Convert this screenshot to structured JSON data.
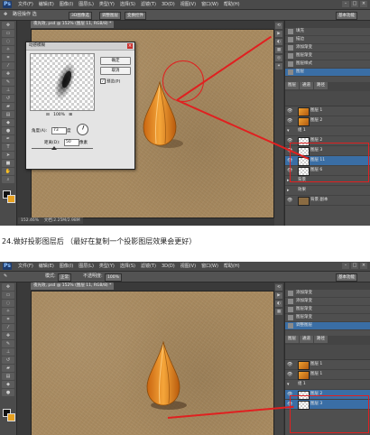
{
  "menu": [
    "文件(F)",
    "编辑(E)",
    "图像(I)",
    "图层(L)",
    "类型(Y)",
    "选择(S)",
    "滤镜(T)",
    "3D(D)",
    "视图(V)",
    "窗口(W)",
    "帮助(H)"
  ],
  "shot1": {
    "options": {
      "tool_label": "路径操作 选",
      "btn1": "3D图像选",
      "btn2": "调整图层",
      "btn3": "变换控件",
      "workspace": "基本功能"
    },
    "doc_tab": "夜光效, psd @ 152% (图层 11, RGB/8) *",
    "status": "152.46%",
    "status_doc": "文档:2.25M/2.98M",
    "dialog": {
      "title": "动感模糊",
      "ok": "确定",
      "cancel": "取消",
      "preview": "预览(P)",
      "zoom": "100%",
      "angle_label": "角度(A):",
      "angle_value": "73",
      "angle_unit": "度",
      "distance_label": "距离(D):",
      "distance_value": "50",
      "distance_unit": "像素"
    },
    "history": [
      "填充",
      "描边",
      "添加渐变",
      "图层渐变",
      "图层样式",
      "图层"
    ],
    "layers_tabs": [
      "图层",
      "通道",
      "路径"
    ],
    "layers": [
      {
        "name": "图层 1",
        "thumb": "drop"
      },
      {
        "name": "图层 2",
        "thumb": "drop"
      },
      {
        "name": "组 1",
        "thumb": "group"
      },
      {
        "name": "图层 2",
        "thumb": "check"
      },
      {
        "name": "图层 3",
        "thumb": "check"
      },
      {
        "name": "图层 11",
        "thumb": "check"
      },
      {
        "name": "图层 6",
        "thumb": "check"
      },
      {
        "name": "背景",
        "thumb": "group"
      },
      {
        "name": "效果",
        "thumb": "group"
      },
      {
        "name": "背景 副本",
        "thumb": "sand"
      }
    ]
  },
  "caption": "24.做好投影图层后 （最好在复制一个投影图层效果会更好）",
  "shot2": {
    "options": {
      "mode_label": "模式:",
      "mode_value": "正常",
      "opacity_label": "不透明度:",
      "opacity_value": "100%",
      "workspace": "基本功能"
    },
    "doc_tab": "夜光效, psd @ 152% (图层 11, RGB/8) *",
    "history": [
      "添加渐变",
      "添加渐变",
      "图层渐变",
      "图层渐变",
      "调整图层"
    ],
    "layers_tabs": [
      "图层",
      "通道",
      "路径"
    ],
    "layers": [
      {
        "name": "图层 1",
        "thumb": "drop"
      },
      {
        "name": "图层 1",
        "thumb": "drop"
      },
      {
        "name": "组 1",
        "thumb": "group"
      },
      {
        "name": "图层 2",
        "thumb": "check"
      },
      {
        "name": "图层 3",
        "thumb": "check"
      }
    ]
  },
  "colors": {
    "accent_red": "#e02020",
    "selection_blue": "#3a6ea5",
    "drop_orange": "#e68a22",
    "sand": "#a88a60"
  }
}
